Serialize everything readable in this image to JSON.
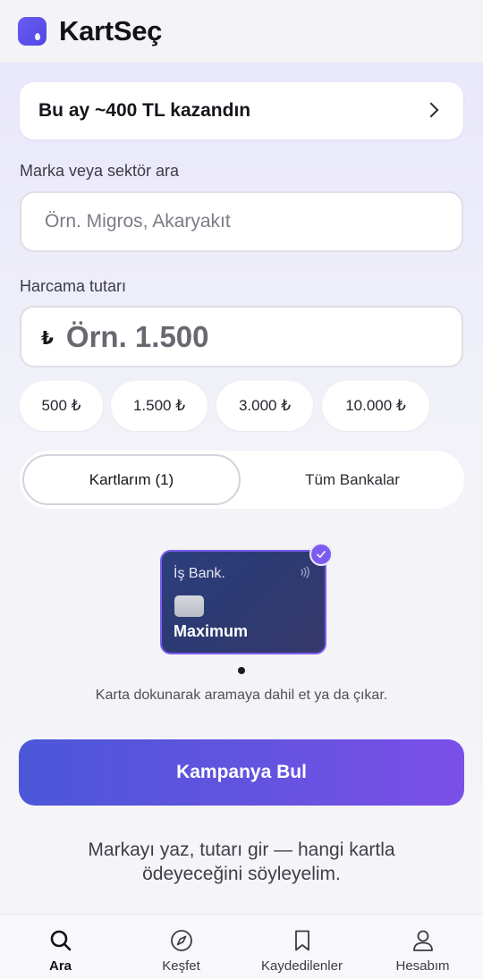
{
  "header": {
    "app_title": "KartSeç",
    "logo_icon": "card-drop-logo-icon"
  },
  "savings": {
    "text": "Bu ay ~400 TL kazandın",
    "icon": "chevron-right-icon"
  },
  "search": {
    "label": "Marka veya sektör ara",
    "placeholder": "Örn. Migros, Akaryakıt",
    "value": ""
  },
  "amount": {
    "label": "Harcama tutarı",
    "currency_symbol": "₺",
    "placeholder": "Örn. 1.500",
    "value": "",
    "chips": [
      "500 ₺",
      "1.500 ₺",
      "3.000 ₺",
      "10.000 ₺"
    ]
  },
  "tabs": [
    {
      "label": "Kartlarım (1)",
      "selected": true
    },
    {
      "label": "Tüm Bankalar",
      "selected": false
    }
  ],
  "cards": [
    {
      "bank": "İş Bank.",
      "brand": "Maximum",
      "selected": true,
      "icons": [
        "contactless-icon",
        "chip-icon",
        "check-icon"
      ]
    }
  ],
  "carousel": {
    "page": 1,
    "total": 1
  },
  "helper_text": "Karta dokunarak aramaya dahil et ya da çıkar.",
  "cta": {
    "label": "Kampanya Bul"
  },
  "tagline": "Markayı yaz, tutarı gir — hangi kartla ödeyeceğini söyleyelim.",
  "nav": [
    {
      "label": "Ara",
      "icon": "search-icon",
      "active": true
    },
    {
      "label": "Keşfet",
      "icon": "compass-icon",
      "active": false
    },
    {
      "label": "Kaydedilenler",
      "icon": "bookmark-icon",
      "active": false
    },
    {
      "label": "Hesabım",
      "icon": "user-icon",
      "active": false
    }
  ],
  "colors": {
    "accent": "#6453e0",
    "card_border": "#7c5cf0",
    "card_bg": "#2c3f7d",
    "cta_start": "#4b57d8",
    "cta_end": "#7b4fe8"
  }
}
